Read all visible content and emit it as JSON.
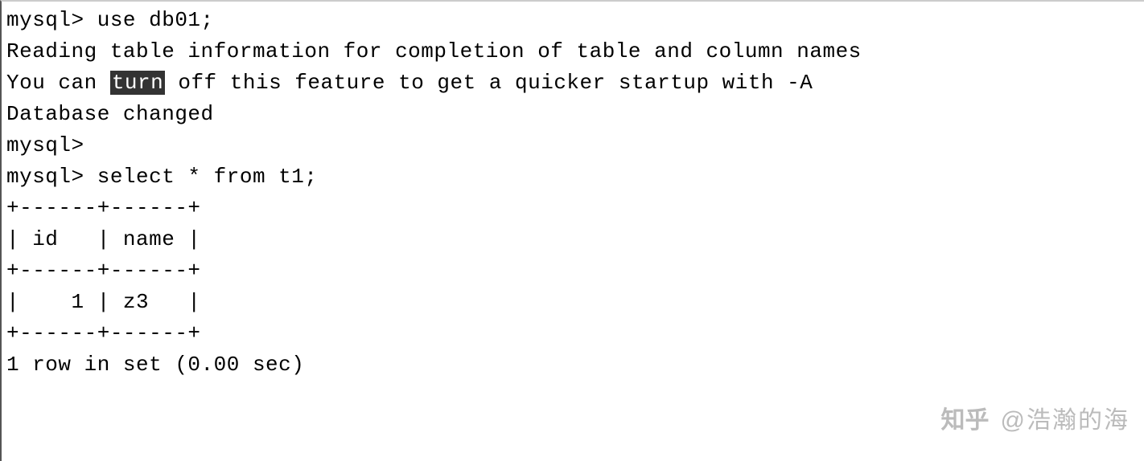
{
  "terminal": {
    "prompt": "mysql>",
    "lines": {
      "cmd1": "mysql> use db01;",
      "msg1": "Reading table information for completion of table and column names",
      "msg2_before": "You can ",
      "msg2_highlight": "turn",
      "msg2_after": " off this feature to get a quicker startup with -A",
      "blank1": "",
      "msg3": "Database changed",
      "prompt_empty": "mysql>",
      "cmd2": "mysql> select * from t1;",
      "table_border": "+------+------+",
      "table_header": "| id   | name |",
      "table_border2": "+------+------+",
      "table_row1": "|    1 | z3   |",
      "table_border3": "+------+------+",
      "result": "1 row in set (0.00 sec)"
    }
  },
  "watermark": {
    "logo": "知乎",
    "author": "@浩瀚的海"
  }
}
